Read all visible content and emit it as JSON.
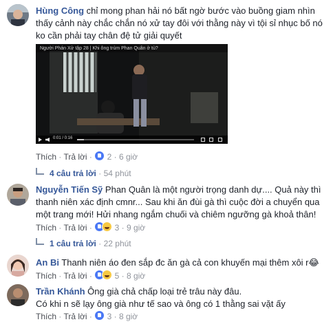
{
  "comments": [
    {
      "author": "Hùng Công",
      "lines": [
        "chỉ mong phan hải nó bất ngờ bước vào buồng giam nhìn",
        "thấy cảnh này chắc chắn nó xử tay đôi với thằng này vì tội sỉ nhục bố nó",
        "ko cần phải tay chân đệ tử giải quyết"
      ],
      "like_label": "Thích",
      "reply_label": "Trả lời",
      "reaction_count": "2",
      "time": "6 giờ",
      "video": {
        "title": "Người Phán Xử tập 28 | Khi ông trùm Phan Quân ở tù?",
        "time": "0:01 / 0:16",
        "progress": 0.06
      },
      "replies": {
        "count": "4 câu trả lời",
        "ago": "54 phút"
      }
    },
    {
      "author": "Nguyễn Tiến Sỹ",
      "lines": [
        "Phan Quân là một người trọng danh dự.... Quả này thì",
        "thanh niên xác định cmnr... Sau khi ăn đùi gà thì cuộc đời a chuyển qua",
        "một trang mới! Hửi nhang ngắm chuối và chiêm ngưỡng gà khoả thân!"
      ],
      "like_label": "Thích",
      "reply_label": "Trả lời",
      "reaction_count": "3",
      "time": "9 giờ",
      "replies": {
        "count": "1 câu trả lời",
        "ago": "22 phút"
      }
    },
    {
      "author": "An Bi",
      "lines": [
        "Thanh niên áo đen sắp đc ăn gà cả con khuyến mại thêm xôi r"
      ],
      "emoji": "😂",
      "like_label": "Thích",
      "reply_label": "Trả lời",
      "reaction_count": "5",
      "time": "8 giờ"
    },
    {
      "author": "Trần Khánh",
      "lines": [
        "Ông già chả chấp loại trẻ trâu này đâu.",
        "Có khi n sẽ lạy ông già như tế sao và ông có 1 thằng sai vặt ấy"
      ],
      "like_label": "Thích",
      "reply_label": "Trả lời",
      "reaction_count": "3",
      "time": "8 giờ"
    }
  ],
  "colors": {
    "name": "#365899",
    "meta": "#90949c",
    "like": "#4a78f5"
  }
}
